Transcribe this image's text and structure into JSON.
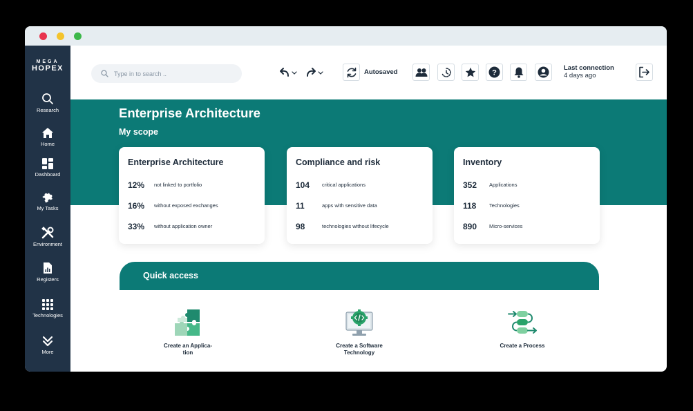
{
  "brand": {
    "line1": "MEGA",
    "line2": "HOPEX"
  },
  "sidebar": {
    "items": [
      {
        "label": "Research",
        "icon": "search-icon"
      },
      {
        "label": "Home",
        "icon": "home-icon"
      },
      {
        "label": "Dashboard",
        "icon": "dashboard-icon"
      },
      {
        "label": "My Tasks",
        "icon": "puzzle-icon"
      },
      {
        "label": "Environment",
        "icon": "tools-icon"
      },
      {
        "label": "Registers",
        "icon": "document-chart-icon"
      },
      {
        "label": "Technologies",
        "icon": "grid-icon"
      },
      {
        "label": "More",
        "icon": "double-chevron-down-icon"
      }
    ]
  },
  "topbar": {
    "search_placeholder": "Type in to search ..",
    "autosaved": "Autosaved",
    "last_connection_title": "Last connection",
    "last_connection_value": "4 days ago"
  },
  "header": {
    "title": "Enterprise Architecture",
    "subtitle": "My scope"
  },
  "cards": [
    {
      "title": "Enterprise Architecture",
      "stats": [
        {
          "value": "12%",
          "label": "not linked to portfolio"
        },
        {
          "value": "16%",
          "label": "without exposed exchanges"
        },
        {
          "value": "33%",
          "label": "without application owner"
        }
      ]
    },
    {
      "title": "Compliance and risk",
      "stats": [
        {
          "value": "104",
          "label": "critical applications"
        },
        {
          "value": "11",
          "label": "apps with sensitive data"
        },
        {
          "value": "98",
          "label": "technologies without lifecycle"
        }
      ]
    },
    {
      "title": "Inventory",
      "stats": [
        {
          "value": "352",
          "label": "Applications"
        },
        {
          "value": "118",
          "label": "Technologies"
        },
        {
          "value": "890",
          "label": "Micro-services"
        }
      ]
    }
  ],
  "quick_access": {
    "title": "Quick access",
    "items": [
      {
        "label_line1": "Create an Applica-",
        "label_line2": "tion",
        "icon": "application-puzzle-icon"
      },
      {
        "label_line1": "Create a Software",
        "label_line2": "Technology",
        "icon": "software-technology-icon"
      },
      {
        "label_line1": "Create a Process",
        "label_line2": "",
        "icon": "process-icon"
      }
    ]
  },
  "colors": {
    "sidebar": "#213347",
    "teal": "#0c7a76",
    "green": "#3cb878",
    "text": "#1d2b3a"
  }
}
